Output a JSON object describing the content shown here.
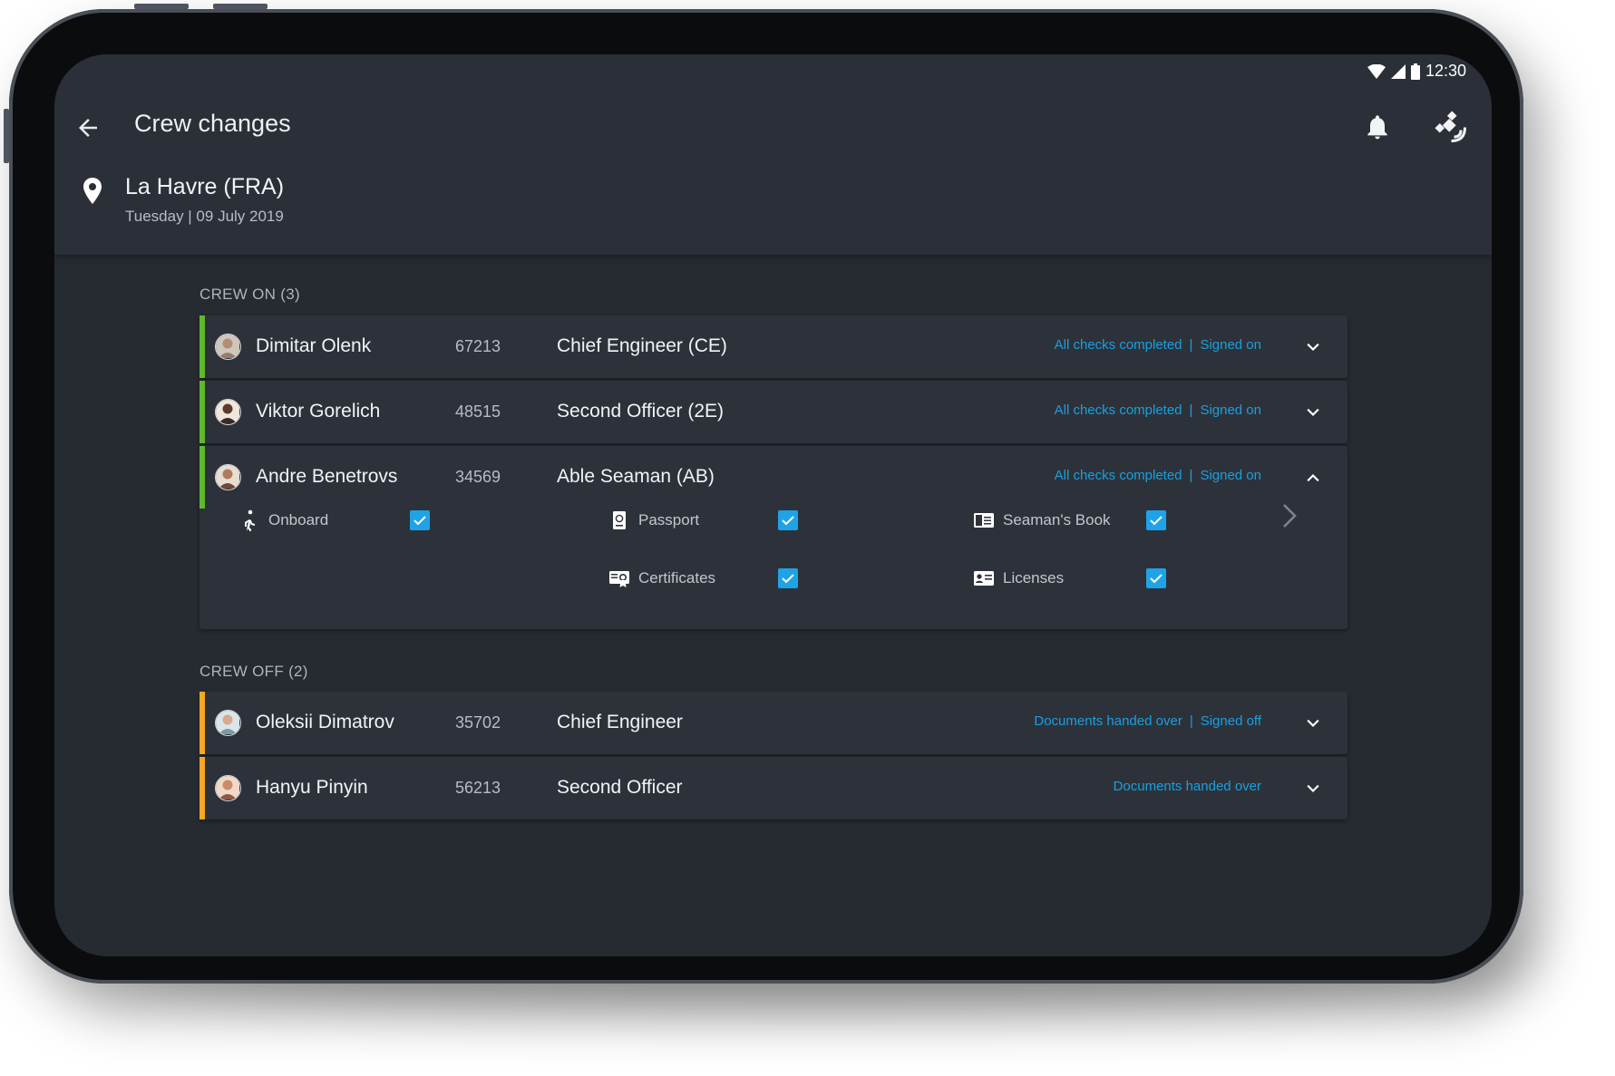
{
  "status_bar": {
    "time": "12:30"
  },
  "appbar": {
    "title": "Crew changes"
  },
  "location": {
    "name": "La Havre (FRA)",
    "date": "Tuesday | 09 July 2019"
  },
  "crew_on": {
    "label": "CREW ON (3)",
    "members": [
      {
        "name": "Dimitar Olenk",
        "id": "67213",
        "role": "Chief Engineer (CE)",
        "status_a": "All checks completed",
        "separator": "|",
        "status_b": "Signed on"
      },
      {
        "name": "Viktor Gorelich",
        "id": "48515",
        "role": "Second Officer (2E)",
        "status_a": "All checks completed",
        "separator": "|",
        "status_b": "Signed on"
      },
      {
        "name": "Andre Benetrovs",
        "id": "34569",
        "role": "Able Seaman (AB)",
        "status_a": "All checks completed",
        "separator": "|",
        "status_b": "Signed on"
      }
    ],
    "checks": {
      "onboard": "Onboard",
      "passport": "Passport",
      "seamans_book": "Seaman's Book",
      "certificates": "Certificates",
      "licenses": "Licenses"
    }
  },
  "crew_off": {
    "label": "CREW OFF (2)",
    "members": [
      {
        "name": "Oleksii Dimatrov",
        "id": "35702",
        "role": "Chief Engineer",
        "status_a": "Documents handed over",
        "separator": "|",
        "status_b": "Signed off"
      },
      {
        "name": "Hanyu Pinyin",
        "id": "56213",
        "role": "Second Officer",
        "status_a": "Documents handed over"
      }
    ]
  },
  "colors": {
    "crew_on_stripe": "#5fb82b",
    "crew_off_stripe": "#f5a623",
    "status_link": "#1a9fe0",
    "checkbox": "#1fa3e8",
    "screen_bg": "#262a31"
  }
}
